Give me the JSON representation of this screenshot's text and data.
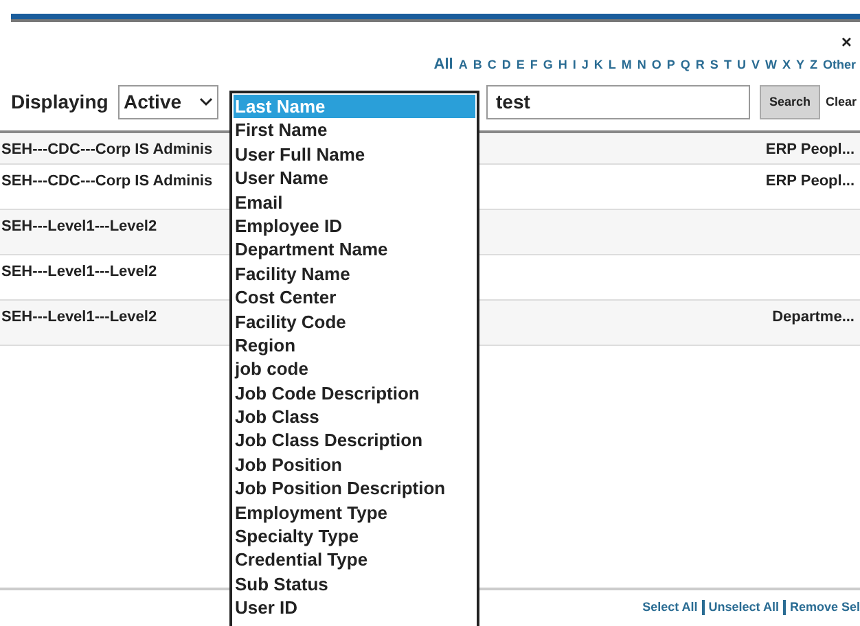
{
  "close": "×",
  "alphabet": {
    "all": "All",
    "letters": [
      "A",
      "B",
      "C",
      "D",
      "E",
      "F",
      "G",
      "H",
      "I",
      "J",
      "K",
      "L",
      "M",
      "N",
      "O",
      "P",
      "Q",
      "R",
      "S",
      "T",
      "U",
      "V",
      "W",
      "X",
      "Y",
      "Z",
      "Other"
    ]
  },
  "filter": {
    "label": "Displaying",
    "status": "Active",
    "search_value": "test",
    "search_button": "Search",
    "clear": "Clear"
  },
  "field_list": [
    {
      "label": "Last Name",
      "selected": true
    },
    {
      "label": "First Name",
      "selected": false
    },
    {
      "label": "User Full Name",
      "selected": false
    },
    {
      "label": "User Name",
      "selected": false
    },
    {
      "label": "Email",
      "selected": false
    },
    {
      "label": "Employee ID",
      "selected": false
    },
    {
      "label": "Department Name",
      "selected": false
    },
    {
      "label": "Facility Name",
      "selected": false
    },
    {
      "label": "Cost Center",
      "selected": false
    },
    {
      "label": "Facility Code",
      "selected": false
    },
    {
      "label": "Region",
      "selected": false
    },
    {
      "label": "job code",
      "selected": false
    },
    {
      "label": "Job Code Description",
      "selected": false
    },
    {
      "label": "Job Class",
      "selected": false
    },
    {
      "label": "Job Class Description",
      "selected": false
    },
    {
      "label": "Job Position",
      "selected": false
    },
    {
      "label": "Job Position Description",
      "selected": false
    },
    {
      "label": "Employment Type",
      "selected": false
    },
    {
      "label": "Specialty Type",
      "selected": false
    },
    {
      "label": "Credential Type",
      "selected": false
    },
    {
      "label": "Sub Status",
      "selected": false
    },
    {
      "label": "User ID",
      "selected": false
    }
  ],
  "table": {
    "rows": [
      {
        "column_1": "SEH---CDC---Corp IS Adminis",
        "column_2": "ERP Peopl..."
      },
      {
        "column_1": "SEH---CDC---Corp IS Adminis",
        "column_2": "ERP Peopl..."
      },
      {
        "column_1": "SEH---Level1---Level2"
      },
      {
        "column_1": "SEH---Level1---Level2"
      },
      {
        "column_1": "SEH---Level1---Level2",
        "column_2": "Departme..."
      }
    ]
  },
  "footer_links": [
    "Select All",
    "Unselect All",
    "Remove Sel"
  ]
}
